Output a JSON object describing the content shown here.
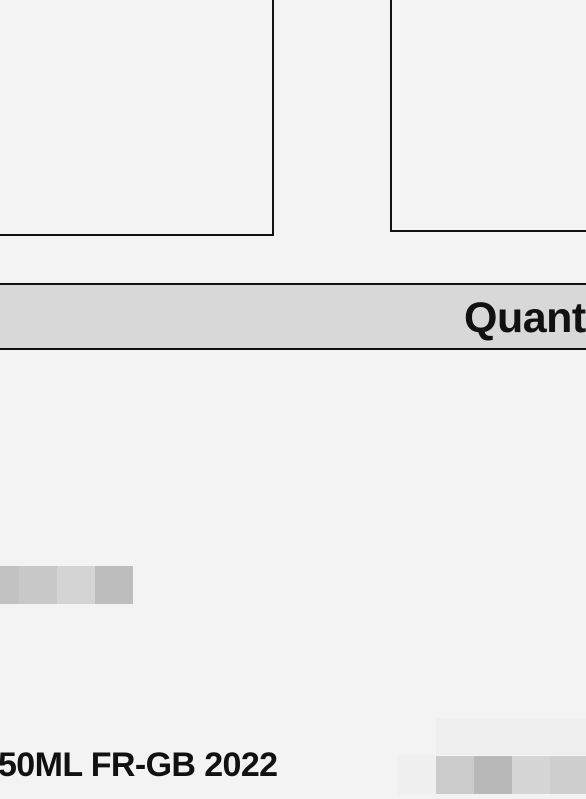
{
  "table": {
    "header_label": "Quant"
  },
  "item": {
    "description": "50ML FR-GB 2022"
  },
  "redactions": {
    "strip_a_colors": [
      "#c2c2c2",
      "#c8c8c8",
      "#d4d4d4",
      "#bdbdbd"
    ],
    "strip_b_colors": [
      "#cbcbcb",
      "#b8b8b8",
      "#d6d6d6",
      "#cfcfcf"
    ]
  }
}
